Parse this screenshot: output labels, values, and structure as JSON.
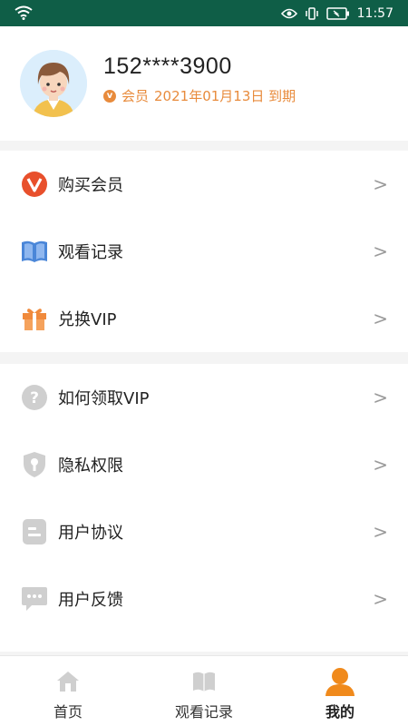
{
  "status_bar": {
    "time": "11:57"
  },
  "profile": {
    "phone": "152****3900",
    "member_label": "会员",
    "member_expiry": "2021年01月13日 到期"
  },
  "menu_group1": [
    {
      "label": "购买会员"
    },
    {
      "label": "观看记录"
    },
    {
      "label": "兑换VIP"
    }
  ],
  "menu_group2": [
    {
      "label": "如何领取VIP"
    },
    {
      "label": "隐私权限"
    },
    {
      "label": "用户协议"
    },
    {
      "label": "用户反馈"
    }
  ],
  "chevron": ">",
  "tabs": [
    {
      "label": "首页",
      "active": false
    },
    {
      "label": "观看记录",
      "active": false
    },
    {
      "label": "我的",
      "active": true
    }
  ],
  "colors": {
    "status_bar": "#0f5e47",
    "accent_orange": "#e88b3c",
    "book_blue": "#4a86d8"
  }
}
